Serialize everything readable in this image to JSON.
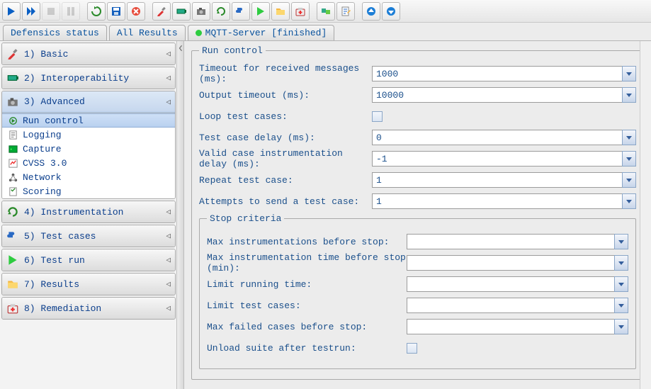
{
  "toolbar_icons": [
    "play-icon",
    "step-icon",
    "stop-icon",
    "pause-icon",
    "spacer",
    "reload-icon",
    "save-icon",
    "cancel-icon",
    "spacer",
    "pipette-icon",
    "battery-icon",
    "camera-icon",
    "refresh-icon",
    "puzzle-icon",
    "run-icon",
    "folder-icon",
    "medkit-icon",
    "spacer",
    "plugins-icon",
    "edit-doc-icon",
    "spacer",
    "up-icon",
    "down-icon"
  ],
  "tabs": [
    {
      "label": "Defensics status",
      "indicator": false
    },
    {
      "label": "All Results",
      "indicator": false
    },
    {
      "label": "MQTT-Server [finished]",
      "indicator": true
    }
  ],
  "sidebar": {
    "sections": [
      {
        "icon": "pipette-icon",
        "label": "1) Basic",
        "expanded": false,
        "active": false
      },
      {
        "icon": "battery-icon",
        "label": "2) Interoperability",
        "expanded": false,
        "active": false
      },
      {
        "icon": "camera-icon",
        "label": "3) Advanced",
        "expanded": true,
        "active": true,
        "items": [
          {
            "icon": "runcontrol-icon",
            "label": "Run control",
            "selected": true
          },
          {
            "icon": "logging-icon",
            "label": "Logging",
            "selected": false
          },
          {
            "icon": "capture-icon",
            "label": "Capture",
            "selected": false
          },
          {
            "icon": "cvss-icon",
            "label": "CVSS 3.0",
            "selected": false
          },
          {
            "icon": "network-icon",
            "label": "Network",
            "selected": false
          },
          {
            "icon": "scoring-icon",
            "label": "Scoring",
            "selected": false
          }
        ]
      },
      {
        "icon": "refresh-icon",
        "label": "4) Instrumentation",
        "expanded": false,
        "active": false
      },
      {
        "icon": "puzzle-icon",
        "label": "5) Test cases",
        "expanded": false,
        "active": false
      },
      {
        "icon": "run-icon",
        "label": "6) Test run",
        "expanded": false,
        "active": false
      },
      {
        "icon": "folder-icon",
        "label": "7) Results",
        "expanded": false,
        "active": false
      },
      {
        "icon": "medkit-icon",
        "label": "8) Remediation",
        "expanded": false,
        "active": false
      }
    ]
  },
  "content": {
    "legend": "Run control",
    "rows": [
      {
        "label": "Timeout for received messages (ms):",
        "value": "1000",
        "type": "combo"
      },
      {
        "label": "Output timeout (ms):",
        "value": "10000",
        "type": "combo"
      },
      {
        "label": "Loop test cases:",
        "type": "checkbox"
      },
      {
        "label": "Test case delay (ms):",
        "value": "0",
        "type": "combo"
      },
      {
        "label": "Valid case instrumentation delay (ms):",
        "value": "-1",
        "type": "combo"
      },
      {
        "label": "Repeat test case:",
        "value": "1",
        "type": "combo"
      },
      {
        "label": "Attempts to send a test case:",
        "value": "1",
        "type": "combo"
      }
    ],
    "stop": {
      "legend": "Stop criteria",
      "rows": [
        {
          "label": "Max instrumentations before stop:",
          "value": "",
          "type": "combo"
        },
        {
          "label": "Max instrumentation time before stop (min):",
          "value": "",
          "type": "combo"
        },
        {
          "label": "Limit running time:",
          "value": "",
          "type": "combo"
        },
        {
          "label": "Limit test cases:",
          "value": "",
          "type": "combo"
        },
        {
          "label": "Max failed cases before stop:",
          "value": "",
          "type": "combo"
        },
        {
          "label": "Unload suite after testrun:",
          "type": "checkbox"
        }
      ]
    }
  }
}
